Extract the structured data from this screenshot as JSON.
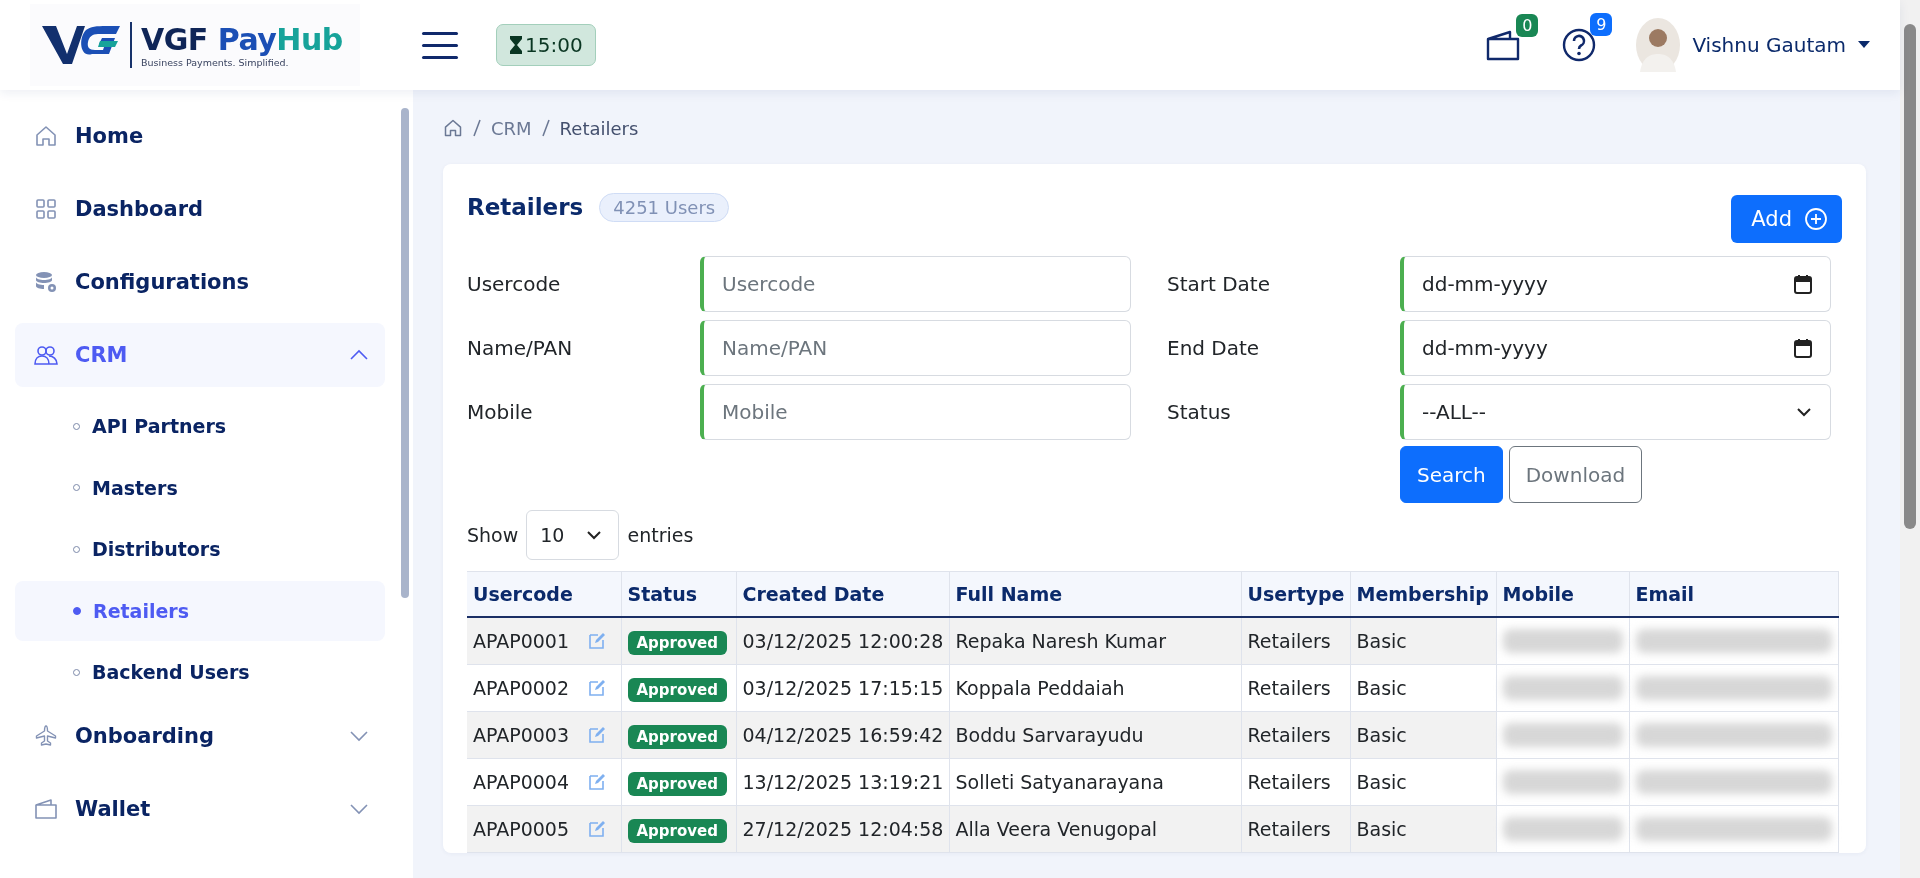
{
  "header": {
    "logo": {
      "brand": "VGF",
      "brand_accent_1": "Pay",
      "brand_accent_2": "Hub",
      "tagline": "Business Payments. Simplified."
    },
    "timer": "15:00",
    "wallet_badge": "0",
    "help_badge": "9",
    "user_name": "Vishnu Gautam"
  },
  "sidebar": {
    "items": [
      {
        "label": "Home",
        "selected": false
      },
      {
        "label": "Dashboard",
        "selected": false
      },
      {
        "label": "Configurations",
        "selected": false
      },
      {
        "label": "CRM",
        "selected": true,
        "expanded": true,
        "children": [
          {
            "label": "API Partners",
            "selected": false
          },
          {
            "label": "Masters",
            "selected": false
          },
          {
            "label": "Distributors",
            "selected": false
          },
          {
            "label": "Retailers",
            "selected": true
          },
          {
            "label": "Backend Users",
            "selected": false
          }
        ]
      },
      {
        "label": "Onboarding",
        "selected": false,
        "expanded": false
      },
      {
        "label": "Wallet",
        "selected": false,
        "expanded": false
      }
    ]
  },
  "breadcrumb": [
    "CRM",
    "Retailers"
  ],
  "card": {
    "title": "Retailers",
    "count": "4251 Users",
    "add_button": "Add"
  },
  "filters": [
    {
      "label": "Usercode",
      "kind": "text",
      "placeholder": "Usercode"
    },
    {
      "label": "Start Date",
      "kind": "date",
      "value": "dd-mm-yyyy"
    },
    {
      "label": "Name/PAN",
      "kind": "text",
      "placeholder": "Name/PAN"
    },
    {
      "label": "End Date",
      "kind": "date",
      "value": "dd-mm-yyyy"
    },
    {
      "label": "Mobile",
      "kind": "text",
      "placeholder": "Mobile"
    },
    {
      "label": "Status",
      "kind": "select",
      "value": "--ALL--"
    }
  ],
  "buttons": [
    "Search",
    "Download"
  ],
  "page_size": {
    "before": "Show",
    "value": "10",
    "after": "entries"
  },
  "table": {
    "columns": [
      "Usercode",
      "Status",
      "Created Date",
      "Full Name",
      "Usertype",
      "Membership",
      "Mobile",
      "Email"
    ],
    "rows": [
      {
        "usercode": "APAP0001",
        "status": "Approved",
        "created": "03/12/2025 12:00:28",
        "name": "Repaka Naresh Kumar",
        "usertype": "Retailers",
        "membership": "Basic"
      },
      {
        "usercode": "APAP0002",
        "status": "Approved",
        "created": "03/12/2025 17:15:15",
        "name": "Koppala Peddaiah",
        "usertype": "Retailers",
        "membership": "Basic"
      },
      {
        "usercode": "APAP0003",
        "status": "Approved",
        "created": "04/12/2025 16:59:42",
        "name": "Boddu Sarvarayudu",
        "usertype": "Retailers",
        "membership": "Basic"
      },
      {
        "usercode": "APAP0004",
        "status": "Approved",
        "created": "13/12/2025 13:19:21",
        "name": "Solleti Satyanarayana",
        "usertype": "Retailers",
        "membership": "Basic"
      },
      {
        "usercode": "APAP0005",
        "status": "Approved",
        "created": "27/12/2025 12:04:58",
        "name": "Alla Veera Venugopal",
        "usertype": "Retailers",
        "membership": "Basic"
      }
    ]
  }
}
